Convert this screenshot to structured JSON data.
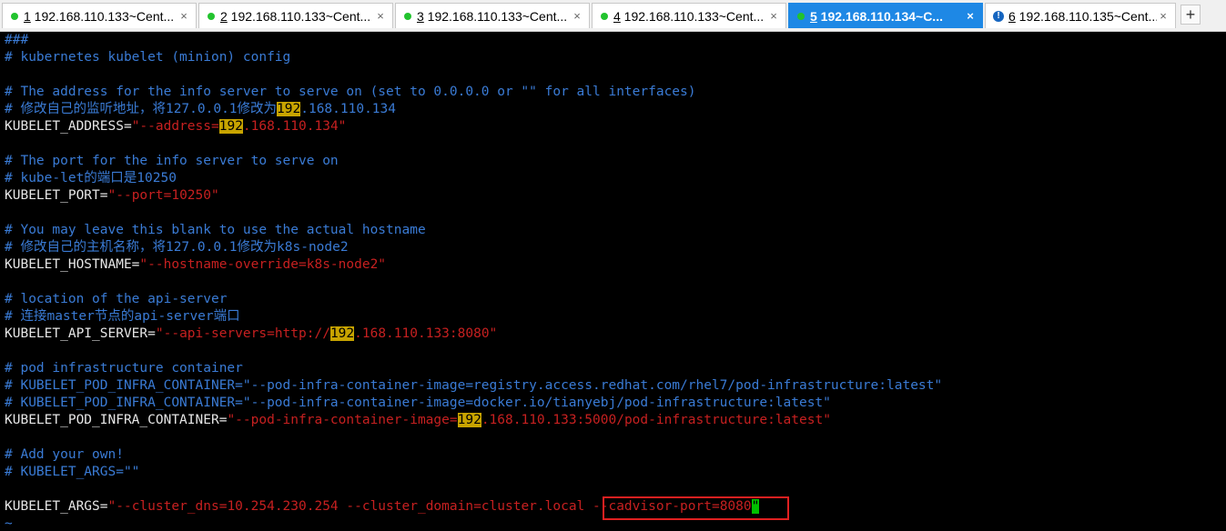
{
  "tabs": [
    {
      "num": "1",
      "title": " 192.168.110.133~Cent...",
      "status": "connected",
      "active": false
    },
    {
      "num": "2",
      "title": " 192.168.110.133~Cent...",
      "status": "connected",
      "active": false
    },
    {
      "num": "3",
      "title": " 192.168.110.133~Cent...",
      "status": "connected",
      "active": false
    },
    {
      "num": "4",
      "title": " 192.168.110.133~Cent...",
      "status": "connected",
      "active": false
    },
    {
      "num": "5",
      "title": " 192.168.110.134~C...",
      "status": "connected",
      "active": true
    },
    {
      "num": "6",
      "title": " 192.168.110.135~Cent...",
      "status": "info",
      "active": false
    }
  ],
  "close_glyph": "×",
  "add_glyph": "+",
  "terminal": {
    "lines": [
      [
        {
          "t": "###",
          "k": "c"
        }
      ],
      [
        {
          "t": "# kubernetes kubelet (minion) config",
          "k": "c"
        }
      ],
      [],
      [
        {
          "t": "# The address for the info server to serve on (set to 0.0.0.0 or \"\" for all interfaces)",
          "k": "c"
        }
      ],
      [
        {
          "t": "# 修改自己的监听地址，将127.0.0.1修改为",
          "k": "c"
        },
        {
          "t": "192",
          "k": "hl"
        },
        {
          "t": ".168.110.134",
          "k": "c"
        }
      ],
      [
        {
          "t": "KUBELET_ADDRESS=",
          "k": "w"
        },
        {
          "t": "\"--address=",
          "k": "s"
        },
        {
          "t": "192",
          "k": "hl"
        },
        {
          "t": ".168.110.134\"",
          "k": "s"
        }
      ],
      [],
      [
        {
          "t": "# The port for the info server to serve on",
          "k": "c"
        }
      ],
      [
        {
          "t": "# kube-let的端口是10250",
          "k": "c"
        }
      ],
      [
        {
          "t": "KUBELET_PORT=",
          "k": "w"
        },
        {
          "t": "\"--port=10250\"",
          "k": "s"
        }
      ],
      [],
      [
        {
          "t": "# You may leave this blank to use the actual hostname",
          "k": "c"
        }
      ],
      [
        {
          "t": "# 修改自己的主机名称，将127.0.0.1修改为k8s-node2",
          "k": "c"
        }
      ],
      [
        {
          "t": "KUBELET_HOSTNAME=",
          "k": "w"
        },
        {
          "t": "\"--hostname-override=k8s-node2\"",
          "k": "s"
        }
      ],
      [],
      [
        {
          "t": "# location of the api-server",
          "k": "c"
        }
      ],
      [
        {
          "t": "# 连接master节点的api-server端口",
          "k": "c"
        }
      ],
      [
        {
          "t": "KUBELET_API_SERVER=",
          "k": "w"
        },
        {
          "t": "\"--api-servers=http://",
          "k": "s"
        },
        {
          "t": "192",
          "k": "hl"
        },
        {
          "t": ".168.110.133:8080\"",
          "k": "s"
        }
      ],
      [],
      [
        {
          "t": "# pod infrastructure container",
          "k": "c"
        }
      ],
      [
        {
          "t": "# KUBELET_POD_INFRA_CONTAINER=\"--pod-infra-container-image=registry.access.redhat.com/rhel7/pod-infrastructure:latest\"",
          "k": "c"
        }
      ],
      [
        {
          "t": "# KUBELET_POD_INFRA_CONTAINER=\"--pod-infra-container-image=docker.io/tianyebj/pod-infrastructure:latest\"",
          "k": "c"
        }
      ],
      [
        {
          "t": "KUBELET_POD_INFRA_CONTAINER=",
          "k": "w"
        },
        {
          "t": "\"--pod-infra-container-image=",
          "k": "s"
        },
        {
          "t": "192",
          "k": "hl"
        },
        {
          "t": ".168.110.133:5000/pod-infrastructure:latest\"",
          "k": "s"
        }
      ],
      [],
      [
        {
          "t": "# Add your own!",
          "k": "c"
        }
      ],
      [
        {
          "t": "# KUBELET_ARGS=\"\"",
          "k": "c"
        }
      ],
      [],
      [
        {
          "t": "KUBELET_ARGS=",
          "k": "w"
        },
        {
          "t": "\"--cluster_dns=10.254.230.254 --cluster_domain=cluster.local --cadvisor-port=8080",
          "k": "s"
        },
        {
          "t": "\"",
          "k": "cursor"
        }
      ],
      [
        {
          "t": "~",
          "k": "tilde"
        }
      ]
    ]
  },
  "colors": {
    "comment": "#3a7bd5",
    "string": "#c62020",
    "plain": "#e6e6e6",
    "search_highlight": "#c8a400",
    "cursor": "#00c000",
    "active_tab": "#1e88e5",
    "annotation_box": "#e02020"
  },
  "icons": {
    "status_connected": "green-dot-icon",
    "status_info": "info-circle-icon",
    "close": "close-icon",
    "add": "plus-icon"
  }
}
